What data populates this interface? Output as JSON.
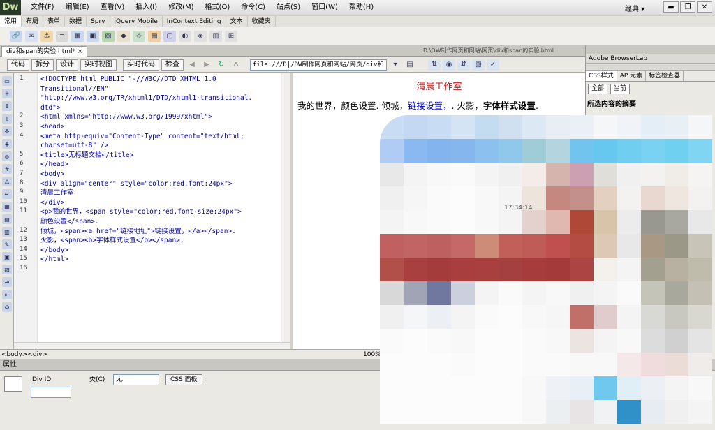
{
  "app": {
    "logo": "Dw",
    "layout": "经典 ▾",
    "menu": [
      "文件(F)",
      "编辑(E)",
      "查看(V)",
      "插入(I)",
      "修改(M)",
      "格式(O)",
      "命令(C)",
      "站点(S)",
      "窗口(W)",
      "帮助(H)"
    ]
  },
  "window_buttons": {
    "minimize": "▬",
    "restore": "❐",
    "close": "✕"
  },
  "insert_bar": {
    "tabs": [
      "常用",
      "布局",
      "表单",
      "数据",
      "Spry",
      "jQuery Mobile",
      "InContext Editing",
      "文本",
      "收藏夹"
    ]
  },
  "document": {
    "tab_label": "div和span的实验.html*",
    "close": "×",
    "path": "D:\\DW制作网页和网站\\网页\\div和span的实验.html"
  },
  "doc_toolbar": {
    "buttons": [
      "代码",
      "拆分",
      "设计",
      "实时视图"
    ],
    "live_code": "实时代码",
    "inspect": "检查",
    "address": "file:///D|/DW制作网页和网站/网页/div和"
  },
  "code": {
    "lines": [
      {
        "n": "1",
        "text": "<!DOCTYPE html PUBLIC \"-//W3C//DTD XHTML 1.0"
      },
      {
        "n": "",
        "text": "Transitional//EN\""
      },
      {
        "n": "",
        "text": "\"http://www.w3.org/TR/xhtml1/DTD/xhtml1-transitional."
      },
      {
        "n": "",
        "text": "dtd\">"
      },
      {
        "n": "2",
        "text": "<html xmlns=\"http://www.w3.org/1999/xhtml\">"
      },
      {
        "n": "3",
        "text": "<head>"
      },
      {
        "n": "4",
        "text": "<meta http-equiv=\"Content-Type\" content=\"text/html;"
      },
      {
        "n": "",
        "text": "charset=utf-8\" />"
      },
      {
        "n": "5",
        "text": "<title>无标题文档</title>"
      },
      {
        "n": "6",
        "text": "</head>"
      },
      {
        "n": "7",
        "text": "<body>"
      },
      {
        "n": "8",
        "text": "<div align=\"center\" style=\"color:red,font:24px\">"
      },
      {
        "n": "9",
        "text": "清晨工作室"
      },
      {
        "n": "10",
        "text": "</div>"
      },
      {
        "n": "11",
        "text": "<p>我的世界，<span style=\"color:red,font-size:24px\">"
      },
      {
        "n": "",
        "text": "颜色设置</span>."
      },
      {
        "n": "12",
        "text": "倾城，<span><a href=\"链接地址\">链接设置，</a></span>."
      },
      {
        "n": "13",
        "text": "火影，<span><b>字体样式设置</b></span>."
      },
      {
        "n": "14",
        "text": "</body>"
      },
      {
        "n": "15",
        "text": "</html>"
      },
      {
        "n": "16",
        "text": ""
      }
    ]
  },
  "design": {
    "title": "清晨工作室",
    "p_a": "我的世界，颜色设置. 倾城，",
    "p_link": "链接设置，",
    "p_b": ". 火影，",
    "p_bold": "字体样式设置",
    "p_end": "."
  },
  "status": {
    "tags": "<body><div>",
    "zoom": "100%"
  },
  "properties": {
    "title": "属性",
    "div_id_label": "Div ID",
    "class_label": "类(C)",
    "class_value": "无",
    "css_panel": "CSS 面板"
  },
  "right_panel": {
    "browserlab": "Adobe BrowserLab",
    "tabs": [
      "CSS样式",
      "AP 元素",
      "标签检查器"
    ],
    "all": "全部",
    "current": "当前",
    "summary": "所选内容的摘要"
  },
  "overlay": {
    "time": "17:34:14"
  },
  "colors": {
    "accent_red": "#d01010",
    "link_blue": "#0000cc"
  }
}
